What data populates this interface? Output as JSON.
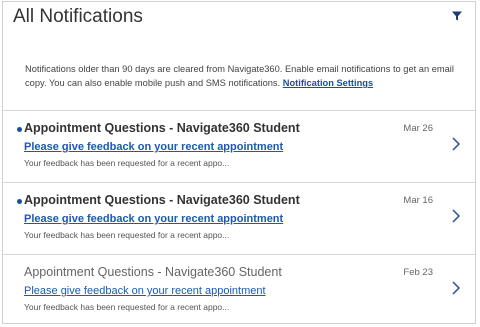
{
  "header": {
    "title": "All Notifications",
    "filter_icon": "filter-icon"
  },
  "info": {
    "text": "Notifications older than 90 days are cleared from Navigate360. Enable email notifications to get an email copy. You can also enable mobile push and SMS notifications.",
    "link_label": "Notification Settings"
  },
  "notifications": [
    {
      "title": "Appointment Questions - Navigate360 Student",
      "link": "Please give feedback on your recent appointment",
      "preview": "Your feedback has been requested for a recent appo...",
      "date": "Mar 26",
      "unread": true
    },
    {
      "title": "Appointment Questions - Navigate360 Student",
      "link": "Please give feedback on your recent appointment",
      "preview": "Your feedback has been requested for a recent appo...",
      "date": "Mar 16",
      "unread": true
    },
    {
      "title": "Appointment Questions - Navigate360 Student",
      "link": "Please give feedback on your recent appointment",
      "preview": "Your feedback has been requested for a recent appo...",
      "date": "Feb 23",
      "unread": false
    }
  ],
  "colors": {
    "link": "#1f57b1",
    "unread_dot": "#1d4f8f",
    "divider": "#d8d8d8"
  }
}
